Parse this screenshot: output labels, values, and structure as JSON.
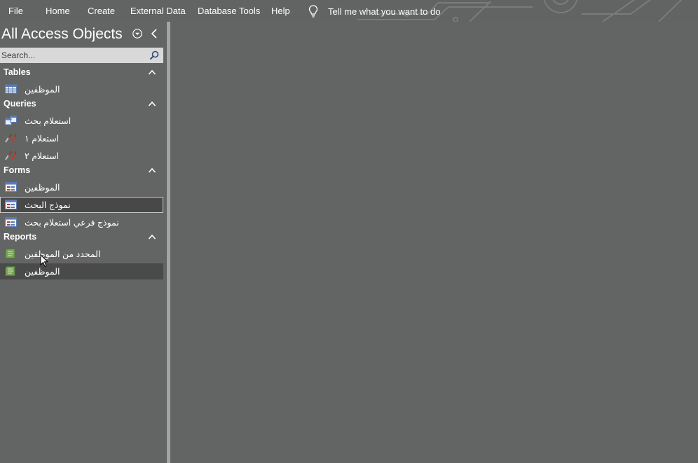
{
  "ribbon": {
    "tabs": [
      "File",
      "Home",
      "Create",
      "External Data",
      "Database Tools",
      "Help"
    ],
    "tell_me": "Tell me what you want to do"
  },
  "nav": {
    "title": "All Access Objects",
    "search_placeholder": "Search...",
    "groups": [
      {
        "label": "Tables",
        "items": [
          {
            "label": "الموظفين",
            "icon": "table-icon"
          }
        ]
      },
      {
        "label": "Queries",
        "items": [
          {
            "label": "استعلام بحث",
            "icon": "select-query-icon"
          },
          {
            "label": "استعلام ١",
            "icon": "action-query-icon"
          },
          {
            "label": "استعلام ٢",
            "icon": "action-query-icon"
          }
        ]
      },
      {
        "label": "Forms",
        "items": [
          {
            "label": "الموظفين",
            "icon": "form-icon"
          },
          {
            "label": "نموذج البحث",
            "icon": "form-icon",
            "state": "selected"
          },
          {
            "label": "نموذج فرعي استعلام بحث",
            "icon": "form-icon"
          }
        ]
      },
      {
        "label": "Reports",
        "items": [
          {
            "label": "المحدد من الموظفين",
            "icon": "report-icon"
          },
          {
            "label": "الموظفين",
            "icon": "report-icon",
            "state": "hover"
          }
        ]
      }
    ]
  },
  "colors": {
    "background": "#636564",
    "selected_row": "#484848",
    "splitter": "#a3a3a3",
    "search_bg": "#d9d9d9"
  }
}
